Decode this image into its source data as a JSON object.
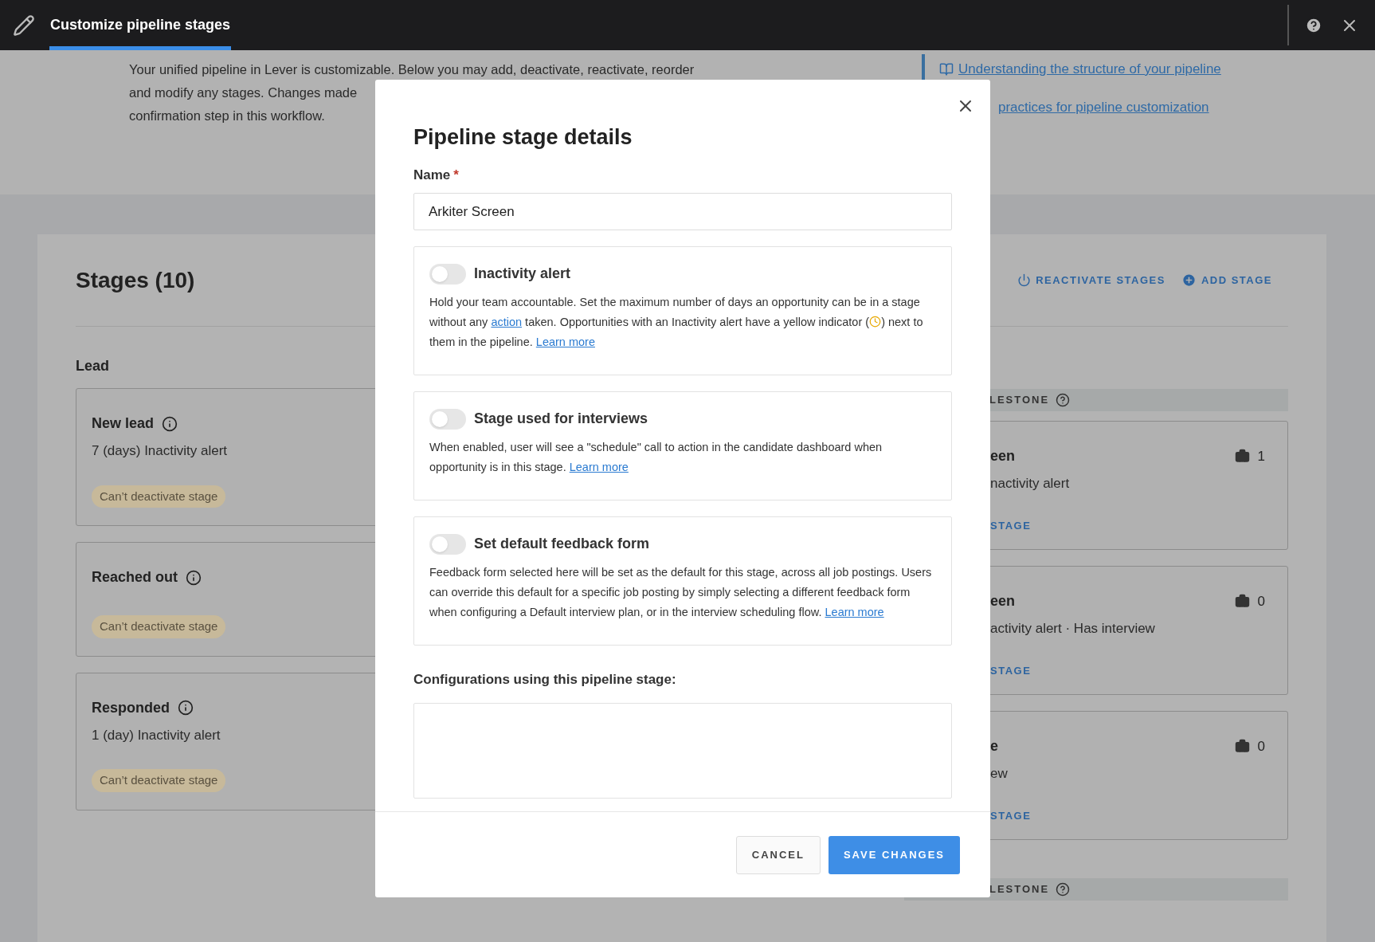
{
  "top_bar": {
    "title": "Customize pipeline stages"
  },
  "intro_lines": [
    "Your unified pipeline in Lever is customizable. Below you may add, deactivate, reactivate, reorder",
    "and modify any stages. Changes made",
    "confirmation step in this workflow."
  ],
  "help_links": [
    "Understanding the structure of your pipeline",
    "practices for pipeline customization"
  ],
  "stages": {
    "title": "Stages (10)",
    "actions": [
      {
        "kind": "reactivate",
        "label": "REACTIVATE STAGES"
      },
      {
        "kind": "add",
        "label": "ADD STAGE"
      }
    ],
    "group": "Lead",
    "cards": [
      {
        "name": "New lead",
        "detail": "7 (days) Inactivity alert",
        "badge": "Can’t deactivate stage"
      },
      {
        "name": "Reached out",
        "badge": "Can’t deactivate stage"
      },
      {
        "name": "Responded",
        "detail": "1 (day) Inactivity alert",
        "badge": "Can’t deactivate stage"
      }
    ],
    "right_sections": [
      {
        "header": "LESTONE",
        "cards": [
          {
            "name": "een",
            "detail": "nactivity alert",
            "count": "1",
            "action": "STAGE"
          },
          {
            "name": "een",
            "detail": "activity alert · Has interview",
            "count": "0",
            "action": "STAGE"
          },
          {
            "name": "e",
            "detail": "ew",
            "count": "0",
            "action": "STAGE"
          }
        ]
      },
      {
        "header": "LESTONE"
      }
    ]
  },
  "modal": {
    "title": "Pipeline stage details",
    "name_label": "Name",
    "required_mark": "*",
    "name_value": "Arkiter Screen",
    "settings": [
      {
        "label": "Inactivity alert",
        "on": false,
        "description": [
          {
            "kind": "text",
            "text": "Hold your team accountable. Set the maximum number of days an opportunity can be in a stage without any "
          },
          {
            "kind": "link",
            "text": "action"
          },
          {
            "kind": "text",
            "text": " taken. Opportunities with an Inactivity alert have a yellow indicator ("
          },
          {
            "kind": "clock"
          },
          {
            "kind": "text",
            "text": ") next to them in the pipeline.  "
          },
          {
            "kind": "link",
            "text": "Learn more"
          }
        ]
      },
      {
        "label": "Stage used for interviews",
        "on": false,
        "description": [
          {
            "kind": "text",
            "text": "When enabled, user will see a \"schedule\" call to action in the candidate dashboard when opportunity is in this stage. "
          },
          {
            "kind": "link",
            "text": "Learn more"
          }
        ]
      },
      {
        "label": "Set default feedback form",
        "on": false,
        "description": [
          {
            "kind": "text",
            "text": "Feedback form selected here will be set as the default for this stage, across all job postings. Users can override this default for a specific job posting by simply selecting a different feedback form when configuring a Default interview plan, or in the interview scheduling flow. "
          },
          {
            "kind": "link",
            "text": "Learn more"
          }
        ]
      }
    ],
    "configurations_label": "Configurations using this pipeline stage:",
    "buttons": [
      {
        "kind": "secondary",
        "label": "CANCEL"
      },
      {
        "kind": "primary",
        "label": "SAVE CHANGES"
      }
    ]
  }
}
